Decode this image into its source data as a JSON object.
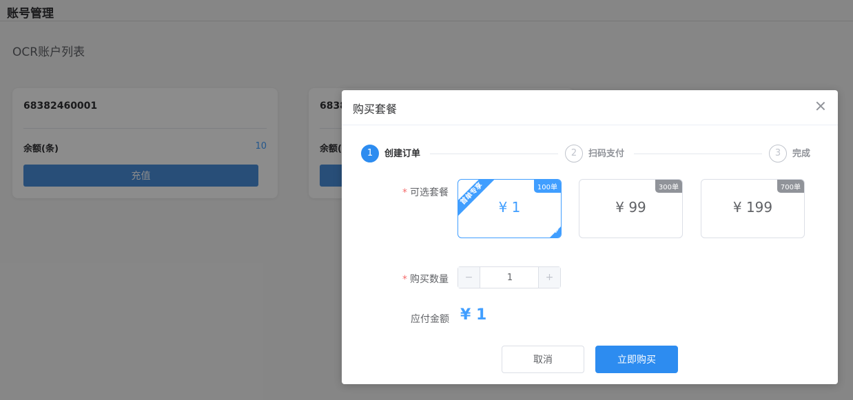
{
  "header": {
    "title": "账号管理"
  },
  "page": {
    "subtitle": "OCR账户列表"
  },
  "cards": [
    {
      "account": "68382460001",
      "balance_label": "余额(条)",
      "balance": "10",
      "recharge_label": "充值"
    },
    {
      "account": "6838",
      "balance_label": "余额(",
      "balance": "",
      "recharge_label": ""
    }
  ],
  "dialog": {
    "title": "购买套餐",
    "steps": [
      {
        "num": "1",
        "label": "创建订单",
        "active": true
      },
      {
        "num": "2",
        "label": "扫码支付",
        "active": false
      },
      {
        "num": "3",
        "label": "完成",
        "active": false
      }
    ],
    "package_label": "可选套餐",
    "required_mark": "*",
    "packages": [
      {
        "price": "¥ 1",
        "badge": "100单",
        "ribbon": "首单专享",
        "selected": true,
        "check": "✓"
      },
      {
        "price": "¥ 99",
        "badge": "300单",
        "selected": false
      },
      {
        "price": "¥ 199",
        "badge": "700单",
        "selected": false
      }
    ],
    "quantity_label": "购买数量",
    "quantity": {
      "minus": "−",
      "value": "1",
      "plus": "+"
    },
    "total_label": "应付金额",
    "total": "¥ 1",
    "cancel_label": "取消",
    "buy_label": "立即购买"
  },
  "colors": {
    "primary": "#409eff",
    "button_blue": "#2d8cf0",
    "required": "#f56c6c",
    "mask": "rgba(0,0,0,0.45)"
  }
}
